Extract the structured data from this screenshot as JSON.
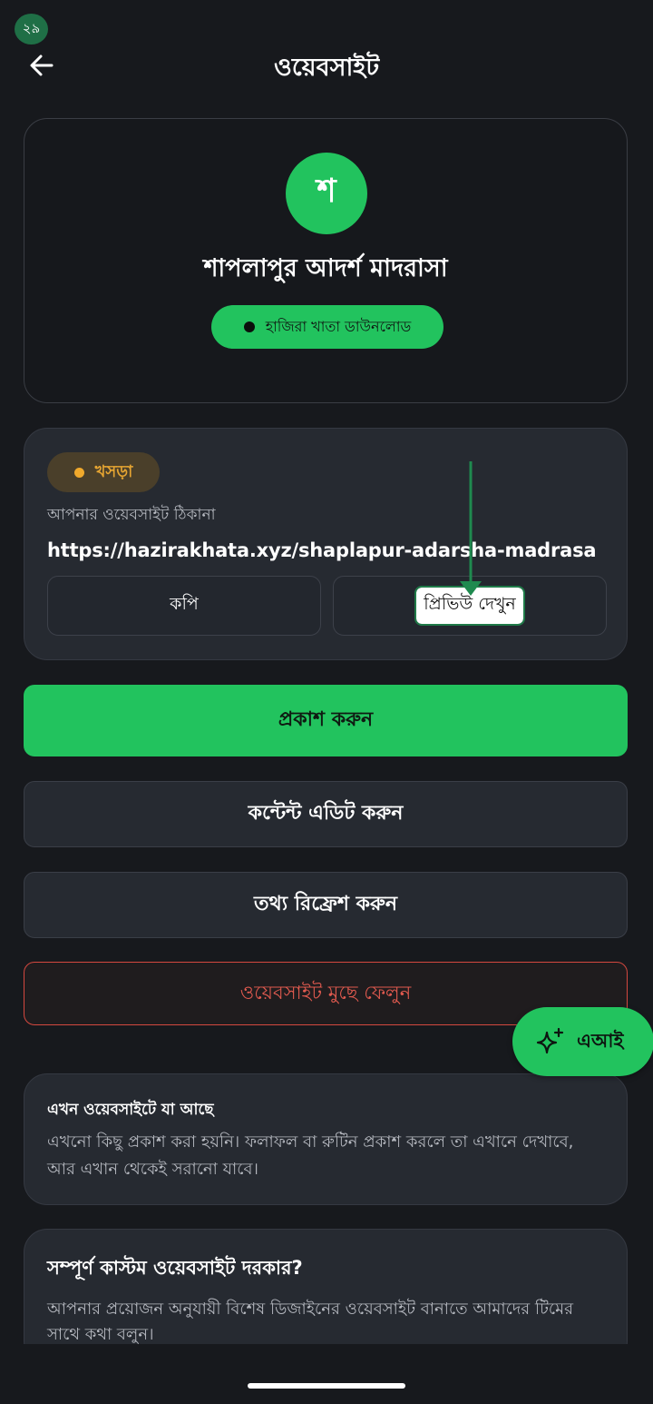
{
  "status_bar": {
    "notification_count": "২৯"
  },
  "header": {
    "back_icon": "arrow-left-icon",
    "title": "ওয়েবসাইট"
  },
  "profile": {
    "avatar_letter": "শ",
    "name": "শাপলাপুর আদর্শ মাদরাসা",
    "brand_label": "হাজিরা খাতা ডাউনলোড"
  },
  "site": {
    "status_label": "খসড়া",
    "address_label": "আপনার ওয়েবসাইট ঠিকানা",
    "url": "https://hazirakhata.xyz/shaplapur-adarsha-madrasa",
    "copy_label": "কপি",
    "preview_label": "প্রিভিউ দেখুন"
  },
  "actions": {
    "publish_label": "প্রকাশ করুন",
    "edit_label": "কন্টেন্ট এডিট করুন",
    "refresh_label": "তথ্য রিফ্রেশ করুন",
    "delete_label": "ওয়েবসাইট মুছে ফেলুন"
  },
  "ai_button": {
    "icon": "sparkles-icon",
    "label": "এআই"
  },
  "current_content": {
    "title": "এখন ওয়েবসাইটে যা আছে",
    "body": "এখনো কিছু প্রকাশ করা হয়নি। ফলাফল বা রুটিন প্রকাশ করলে তা এখানে দেখাবে, আর এখান থেকেই সরানো যাবে।"
  },
  "custom_site": {
    "title": "সম্পূর্ণ কাস্টম ওয়েবসাইট দরকার?",
    "body": "আপনার প্রয়োজন অনুযায়ী বিশেষ ডিজাইনের ওয়েবসাইট বানাতে আমাদের টিমের সাথে কথা বলুন।"
  },
  "colors": {
    "background": "#17191d",
    "accent_green": "#22c35e",
    "card": "#262a31",
    "draft": "#e6a532",
    "danger": "#e05a4f"
  }
}
